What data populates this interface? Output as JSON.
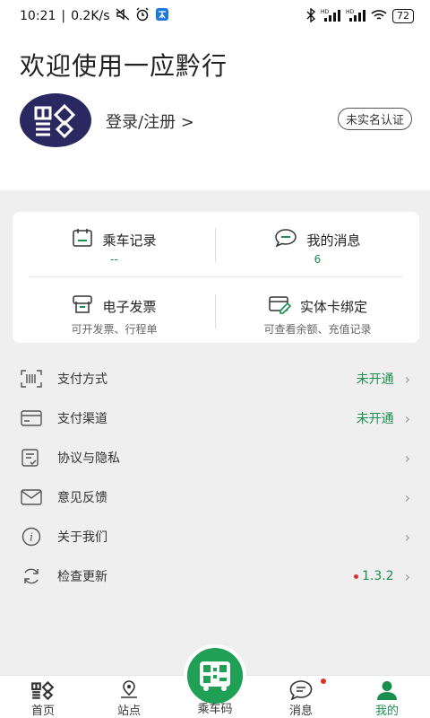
{
  "status": {
    "time": "10:21",
    "speed": "0.2K/s",
    "net1": "HD",
    "net2": "HD",
    "battery": "72"
  },
  "header": {
    "welcome": "欢迎使用一应黔行",
    "login": "登录/注册 >",
    "realname": "未实名认证"
  },
  "card": {
    "ride_record": {
      "title": "乘车记录",
      "value": "--"
    },
    "my_messages": {
      "title": "我的消息",
      "value": "6"
    },
    "e_invoice": {
      "title": "电子发票",
      "sub": "可开发票、行程单"
    },
    "card_bind": {
      "title": "实体卡绑定",
      "sub": "可查看余额、充值记录"
    }
  },
  "menu": [
    {
      "label": "支付方式",
      "status": "未开通"
    },
    {
      "label": "支付渠道",
      "status": "未开通"
    },
    {
      "label": "协议与隐私",
      "status": ""
    },
    {
      "label": "意见反馈",
      "status": ""
    },
    {
      "label": "关于我们",
      "status": ""
    },
    {
      "label": "检查更新",
      "version": "1.3.2"
    }
  ],
  "tabbar": {
    "home": "首页",
    "station": "站点",
    "code": "乘车码",
    "messages": "消息",
    "mine": "我的"
  },
  "colors": {
    "accent": "#1b8f4e",
    "fab": "#1fa055",
    "avatar_bg": "#2a2860",
    "dot": "#d9302c"
  }
}
